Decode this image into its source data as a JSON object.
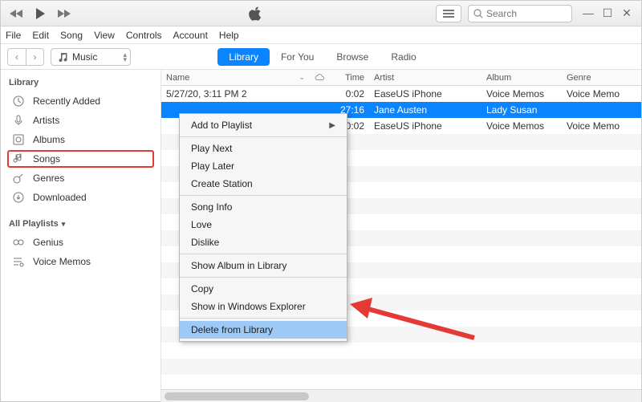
{
  "search": {
    "placeholder": "Search"
  },
  "menubar": [
    "File",
    "Edit",
    "Song",
    "View",
    "Controls",
    "Account",
    "Help"
  ],
  "source_select": {
    "label": "Music"
  },
  "tabs": [
    {
      "label": "Library",
      "active": true
    },
    {
      "label": "For You",
      "active": false
    },
    {
      "label": "Browse",
      "active": false
    },
    {
      "label": "Radio",
      "active": false
    }
  ],
  "sidebar": {
    "header_library": "Library",
    "header_playlists": "All Playlists",
    "library_items": [
      {
        "name": "recently-added",
        "label": "Recently Added"
      },
      {
        "name": "artists",
        "label": "Artists"
      },
      {
        "name": "albums",
        "label": "Albums"
      },
      {
        "name": "songs",
        "label": "Songs",
        "highlighted": true
      },
      {
        "name": "genres",
        "label": "Genres"
      },
      {
        "name": "downloaded",
        "label": "Downloaded"
      }
    ],
    "playlist_items": [
      {
        "name": "genius",
        "label": "Genius"
      },
      {
        "name": "voice-memos",
        "label": "Voice Memos"
      }
    ]
  },
  "table": {
    "columns": {
      "name": "Name",
      "time": "Time",
      "artist": "Artist",
      "album": "Album",
      "genre": "Genre"
    },
    "rows": [
      {
        "name": "5/27/20, 3:11 PM 2",
        "time": "0:02",
        "artist": "EaseUS iPhone",
        "album": "Voice Memos",
        "genre": "Voice Memo",
        "selected": false
      },
      {
        "name": "",
        "time": "27:16",
        "artist": "Jane Austen",
        "album": "Lady Susan",
        "genre": "",
        "selected": true
      },
      {
        "name": "",
        "time": "0:02",
        "artist": "EaseUS iPhone",
        "album": "Voice Memos",
        "genre": "Voice Memo",
        "selected": false
      }
    ]
  },
  "context_menu": {
    "groups": [
      [
        {
          "label": "Add to Playlist",
          "submenu": true
        }
      ],
      [
        {
          "label": "Play Next"
        },
        {
          "label": "Play Later"
        },
        {
          "label": "Create Station"
        }
      ],
      [
        {
          "label": "Song Info"
        },
        {
          "label": "Love"
        },
        {
          "label": "Dislike"
        }
      ],
      [
        {
          "label": "Show Album in Library"
        }
      ],
      [
        {
          "label": "Copy"
        },
        {
          "label": "Show in Windows Explorer"
        }
      ],
      [
        {
          "label": "Delete from Library",
          "selected": true
        }
      ]
    ]
  }
}
